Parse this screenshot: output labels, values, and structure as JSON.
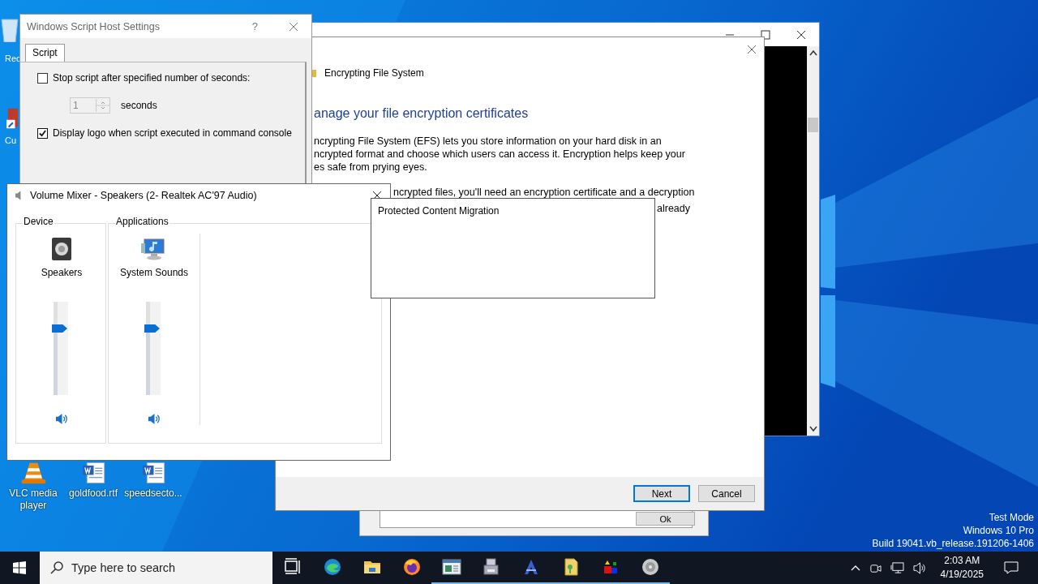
{
  "desktop_icons": [
    {
      "label": "Rec",
      "kind": "recycle"
    },
    {
      "label": "Cu",
      "kind": "shortcut"
    },
    {
      "label": "VLC media player",
      "kind": "vlc"
    },
    {
      "label": "goldfood.rtf",
      "kind": "doc"
    },
    {
      "label": "speedsecto...",
      "kind": "doc"
    }
  ],
  "back_dialog": {
    "button": "Ok"
  },
  "efs_wizard": {
    "title": "Encrypting File System",
    "heading": "anage your file encryption certificates",
    "paragraphs": [
      {
        "lines": [
          "ncrypting File System (EFS) lets you store information on your hard disk in an",
          "ncrypted format and choose which users can access it. Encryption helps keep your",
          "es safe from prying eyes."
        ]
      },
      {
        "lines": [
          "ncrypted files, you'll need an encryption certificate and a decryption"
        ],
        "tail": "already"
      }
    ],
    "buttons": [
      {
        "label": "Next",
        "default": true
      },
      {
        "label": "Cancel",
        "default": false
      }
    ]
  },
  "script_host_settings": {
    "title": "Windows Script Host Settings",
    "help": "?",
    "tabs": [
      {
        "label": "Script",
        "selected": true
      }
    ],
    "options": [
      {
        "kind": "checkbox",
        "label": "Stop script after specified number of seconds:",
        "checked": false
      },
      {
        "kind": "spinner",
        "value": "1",
        "unit": "seconds",
        "disabled": true
      },
      {
        "kind": "checkbox",
        "label": "Display logo when script executed in command console",
        "checked": true
      }
    ]
  },
  "volume_mixer": {
    "title": "Volume Mixer - Speakers (2- Realtek AC'97 Audio)",
    "groups": [
      {
        "label": "Device",
        "channels": [
          {
            "name": "Speakers",
            "kind": "speaker",
            "level": 0.67,
            "muted": false
          }
        ]
      },
      {
        "label": "Applications",
        "channels": [
          {
            "name": "System Sounds",
            "kind": "system",
            "level": 0.67,
            "muted": false
          }
        ]
      }
    ]
  },
  "migration_window": {
    "title": "Protected Content Migration"
  },
  "system_notice": [
    "Test Mode",
    "Windows 10 Pro",
    "Build 19041.vb_release.191206-1406"
  ],
  "taskbar": {
    "search": {
      "placeholder": "Type here to search"
    },
    "apps": [
      {
        "kind": "taskview",
        "running": false
      },
      {
        "kind": "edge",
        "running": false
      },
      {
        "kind": "explorer",
        "running": false
      },
      {
        "kind": "firefox",
        "running": false
      },
      {
        "kind": "window",
        "running": true
      },
      {
        "kind": "printer",
        "running": true
      },
      {
        "kind": "font",
        "running": true
      },
      {
        "kind": "zipfolder",
        "running": true
      },
      {
        "kind": "shapes",
        "running": true
      },
      {
        "kind": "disc",
        "running": true
      }
    ],
    "time": "2:03 AM",
    "date": "4/19/2025"
  }
}
